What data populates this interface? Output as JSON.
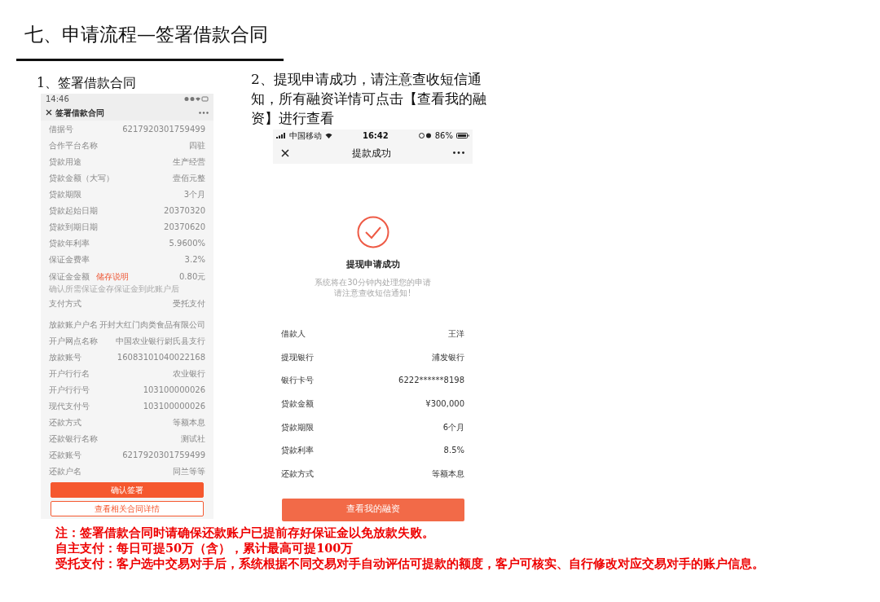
{
  "slide_title": "七、申请流程—签署借款合同",
  "left": {
    "caption": "1、签署借款合同",
    "phone": {
      "time": "14:46",
      "nav_title": "签署借款合同",
      "sections": [
        [
          {
            "label": "借据号",
            "value": "6217920301759499"
          },
          {
            "label": "合作平台名称",
            "value": "四驻"
          },
          {
            "label": "贷款用途",
            "value": "生产经营"
          },
          {
            "label": "贷款金额（大写）",
            "value": "壹佰元整"
          },
          {
            "label": "贷款期限",
            "value": "3个月"
          },
          {
            "label": "贷款起始日期",
            "value": "20370320"
          },
          {
            "label": "贷款到期日期",
            "value": "20370620"
          },
          {
            "label": "贷款年利率",
            "value": "5.9600%"
          },
          {
            "label": "保证金费率",
            "value": "3.2%"
          },
          {
            "label": "保证金金额",
            "value": "0.80元",
            "link": "储存说明",
            "hint": "确认所需保证金存保证金到此账户后"
          },
          {
            "label": "支付方式",
            "value": "受托支付"
          }
        ],
        [
          {
            "label": "放款账户户名",
            "value": "开封大红门肉类食品有限公司"
          },
          {
            "label": "开户网点名称",
            "value": "中国农业银行尉氏县支行"
          },
          {
            "label": "放款账号",
            "value": "16083101040022168"
          },
          {
            "label": "开户行行名",
            "value": "农业银行"
          },
          {
            "label": "开户行行号",
            "value": "103100000026"
          },
          {
            "label": "现代支付号",
            "value": "103100000026"
          },
          {
            "label": "还款方式",
            "value": "等额本息"
          },
          {
            "label": "还款银行名称",
            "value": "测试社"
          },
          {
            "label": "还款账号",
            "value": "6217920301759499"
          },
          {
            "label": "还款户名",
            "value": "同兰等等"
          }
        ]
      ],
      "buttons": [
        {
          "label": "确认签署",
          "kind": "primary"
        },
        {
          "label": "查看相关合同详情",
          "kind": "outline"
        }
      ]
    }
  },
  "right": {
    "caption": "2、提现申请成功，请注意查收短信通知，所有融资详情可点击【查看我的融资】进行查看",
    "phone": {
      "carrier": "中国移动",
      "time": "16:42",
      "battery": "86%",
      "nav_title": "提款成功",
      "result_title": "提现申请成功",
      "message": [
        "系统将在30分钟内处理您的申请",
        "请注意查收短信通知!"
      ],
      "rows": [
        {
          "label": "借款人",
          "value": "王洋"
        },
        {
          "label": "提现银行",
          "value": "浦发银行"
        },
        {
          "label": "银行卡号",
          "value": "6222******8198"
        },
        {
          "label": "贷款金额",
          "value": "¥300,000"
        },
        {
          "label": "贷款期限",
          "value": "6个月"
        },
        {
          "label": "贷款利率",
          "value": "8.5%"
        },
        {
          "label": "还款方式",
          "value": "等额本息"
        }
      ],
      "button": "查看我的融资"
    }
  },
  "notes": [
    "注：签署借款合同时请确保还款账户已提前存好保证金以免放款失败。",
    "自主支付：每日可提50万（含），累计最高可提100万",
    "受托支付：客户选中交易对手后，系统根据不同交易对手自动评估可提款的额度，客户可核实、自行修改对应交易对手的账户信息。"
  ]
}
